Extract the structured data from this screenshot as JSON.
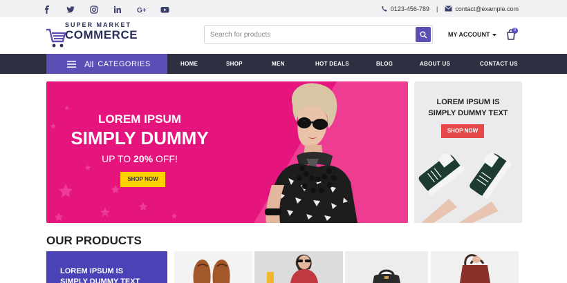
{
  "topbar": {
    "social": [
      "facebook-icon",
      "twitter-icon",
      "instagram-icon",
      "linkedin-icon",
      "google-plus-icon",
      "youtube-icon"
    ],
    "phone": "0123-456-789",
    "separator": "|",
    "email": "contact@example.com"
  },
  "header": {
    "logo_small": "SUPER MARKET",
    "logo_big": "COMMERCE",
    "search_placeholder": "Search for products",
    "account_label": "MY ACCOUNT",
    "cart_count": "0"
  },
  "nav": {
    "categories_all": "All",
    "categories_label": "CATEGORIES",
    "items": [
      "HOME",
      "SHOP",
      "MEN",
      "HOT DEALS",
      "BLOG",
      "ABOUT US",
      "CONTACT US"
    ]
  },
  "hero": {
    "line1": "LOREM IPSUM",
    "line2": "SIMPLY DUMMY",
    "line3_prefix": "UP TO ",
    "line3_highlight": "20%",
    "line3_suffix": " OFF!",
    "button": "SHOP NOW"
  },
  "side_promo": {
    "line1": "LOREM IPSUM IS",
    "line2": "SIMPLY DUMMY TEXT",
    "button": "SHOP NOW"
  },
  "products": {
    "title": "OUR PRODUCTS",
    "promo_line1": "LOREM IPSUM IS",
    "promo_line2": "SIMPLY DUMMY TEXT"
  },
  "colors": {
    "accent": "#5b4fb5",
    "nav_bg": "#2d3041",
    "hero_bg": "#e6157e",
    "hero_button": "#ffd200",
    "side_button": "#e74848"
  }
}
